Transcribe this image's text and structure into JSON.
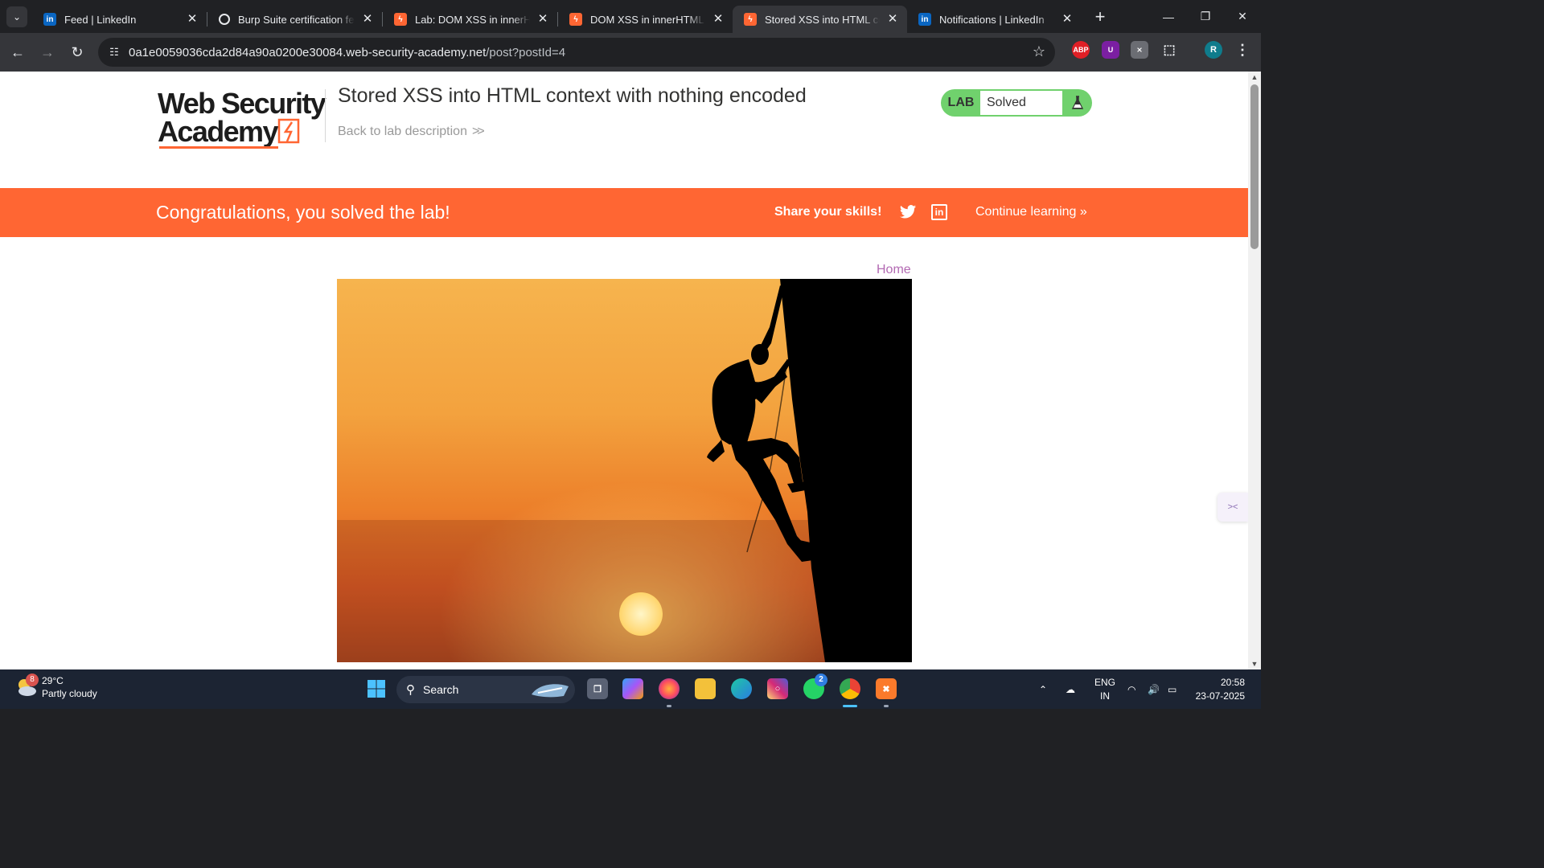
{
  "browser": {
    "tabs": [
      {
        "title": "Feed | LinkedIn",
        "favicon": "linkedin-icon",
        "active": false
      },
      {
        "title": "Burp Suite certification fee",
        "favicon": "openai-icon",
        "active": false
      },
      {
        "title": "Lab: DOM XSS in innerHTML",
        "favicon": "portswigger-icon",
        "active": false
      },
      {
        "title": "DOM XSS in innerHTML sink",
        "favicon": "portswigger-icon",
        "active": false
      },
      {
        "title": "Stored XSS into HTML context",
        "favicon": "portswigger-icon",
        "active": true
      },
      {
        "title": "Notifications | LinkedIn",
        "favicon": "linkedin-icon",
        "active": false
      }
    ],
    "url_host": "0a1e0059036cda2d84a90a0200e30084.web-security-academy.net",
    "url_path": "/post?postId=4",
    "profile_initial": "R",
    "extensions": {
      "abp": "ABP",
      "ublock": "U"
    }
  },
  "lab": {
    "logo_line1": "Web Security",
    "logo_line2": "Academy",
    "title": "Stored XSS into HTML context with nothing encoded",
    "back_link": "Back to lab description",
    "status_label": "LAB",
    "status_value": "Solved",
    "status_color": "#70d16d"
  },
  "banner": {
    "message": "Congratulations, you solved the lab!",
    "share": "Share your skills!",
    "continue": "Continue learning",
    "color": "#ff6633"
  },
  "blog": {
    "home_link": "Home",
    "image_alt": "climber silhouette at sunset"
  },
  "taskbar": {
    "weather_temp": "29°C",
    "weather_desc": "Partly cloudy",
    "weather_badge": "8",
    "search_label": "Search",
    "whatsapp_badge": "2",
    "lang_line1": "ENG",
    "lang_line2": "IN",
    "time": "20:58",
    "date": "23-07-2025"
  }
}
